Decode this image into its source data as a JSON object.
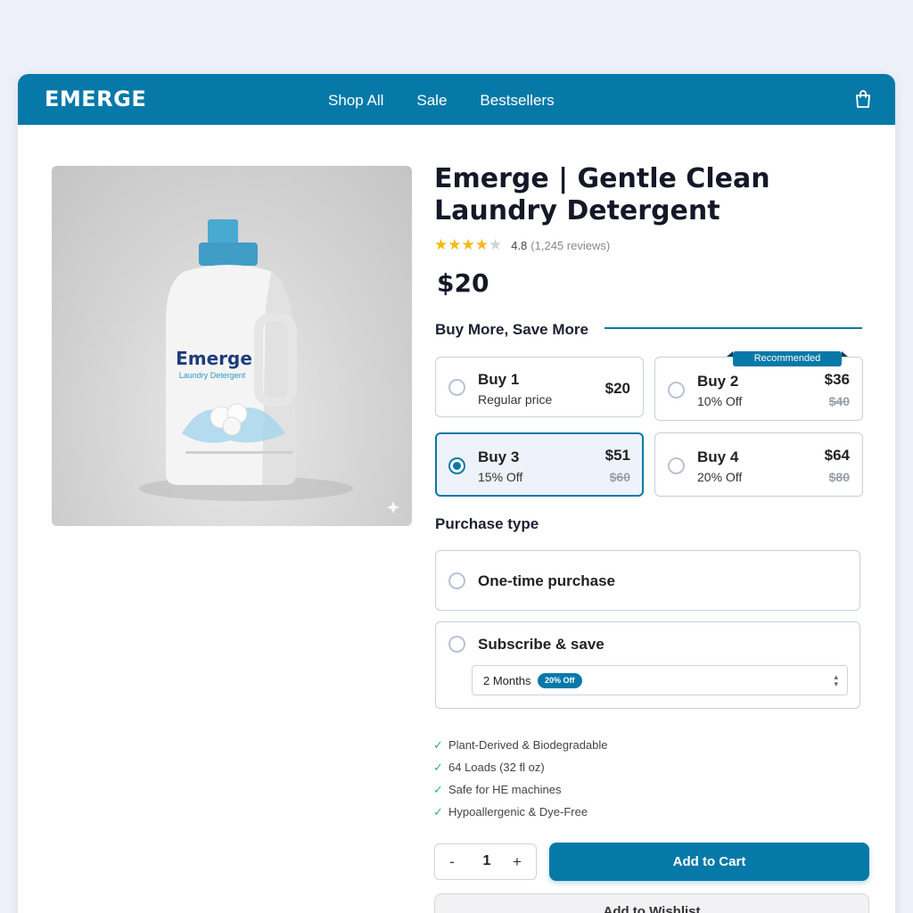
{
  "header": {
    "brand": "EMERGE",
    "nav": [
      "Shop All",
      "Sale",
      "Bestsellers"
    ],
    "cart_icon": "shopping-bag-icon"
  },
  "colors": {
    "primary": "#0779a8",
    "stars": "#f5b913",
    "check": "#2eb85c"
  },
  "product": {
    "title": "Emerge | Gentle Clean Laundry Detergent",
    "rating_value": "4.8",
    "rating_count": "(1,245 reviews)",
    "rating_stars": 4,
    "price": "$20",
    "image": {
      "brand_text": "Emerge",
      "sub_text": "Laundry Detergent"
    }
  },
  "bundles": {
    "heading": "Buy More, Save More",
    "recommended_badge": "Recommended",
    "options": [
      {
        "title": "Buy 1",
        "subtitle": "Regular price",
        "price": "$20",
        "old_price": ""
      },
      {
        "title": "Buy 2",
        "subtitle": "10% Off",
        "price": "$36",
        "old_price": "$40"
      },
      {
        "title": "Buy 3",
        "subtitle": "15% Off",
        "price": "$51",
        "old_price": "$60"
      },
      {
        "title": "Buy 4",
        "subtitle": "20% Off",
        "price": "$64",
        "old_price": "$80"
      }
    ],
    "selected": "Buy 3"
  },
  "purchase_type": {
    "heading": "Purchase type",
    "one_time": "One-time purchase",
    "subscribe": "Subscribe & save",
    "frequency": "2 Months",
    "frequency_badge": "20% Off"
  },
  "features": [
    "Plant-Derived & Biodegradable",
    "64 Loads (32 fl oz)",
    "Safe for HE machines",
    "Hypoallergenic & Dye-Free"
  ],
  "cart": {
    "minus": "-",
    "quantity": "1",
    "plus": "+",
    "add_to_cart": "Add to Cart",
    "add_to_wishlist": "Add to Wishlist"
  }
}
